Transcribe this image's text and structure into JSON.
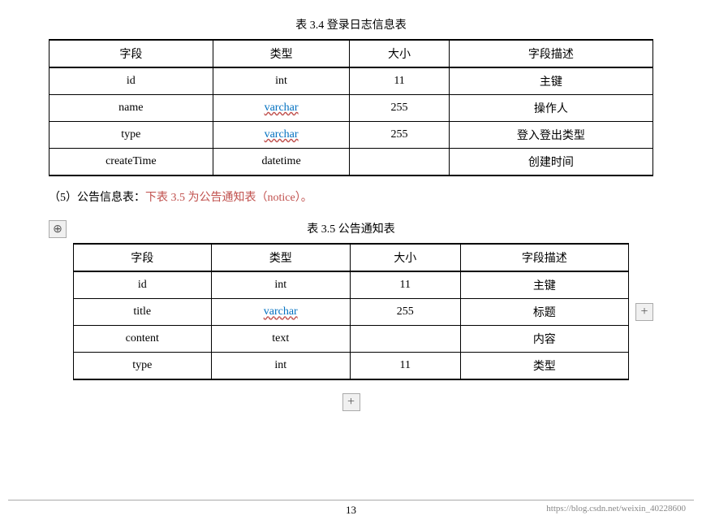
{
  "table1": {
    "title": "表 3.4  登录日志信息表",
    "headers": [
      "字段",
      "类型",
      "大小",
      "字段描述"
    ],
    "rows": [
      {
        "field": "id",
        "type": "int",
        "typeStyle": "plain",
        "size": "11",
        "desc": "主键"
      },
      {
        "field": "name",
        "type": "varchar",
        "typeStyle": "varchar",
        "size": "255",
        "desc": "操作人"
      },
      {
        "field": "type",
        "type": "varchar",
        "typeStyle": "varchar",
        "size": "255",
        "desc": "登入登出类型"
      },
      {
        "field": "createTime",
        "type": "datetime",
        "typeStyle": "plain",
        "size": "",
        "desc": "创建时间"
      }
    ]
  },
  "paragraph": {
    "prefix": "（5）公告信息表：",
    "highlight": "下表 3.5 为公告通知表（notice）。",
    "full": "（5）公告信息表：下表 3.5 为公告通知表（notice）。"
  },
  "table2": {
    "title": "表 3.5  公告通知表",
    "headers": [
      "字段",
      "类型",
      "大小",
      "字段描述"
    ],
    "rows": [
      {
        "field": "id",
        "type": "int",
        "typeStyle": "plain",
        "size": "11",
        "desc": "主键"
      },
      {
        "field": "title",
        "type": "varchar",
        "typeStyle": "varchar",
        "size": "255",
        "desc": "标题"
      },
      {
        "field": "content",
        "type": "text",
        "typeStyle": "plain",
        "size": "",
        "desc": "内容"
      },
      {
        "field": "type",
        "type": "int",
        "typeStyle": "plain",
        "size": "11",
        "desc": "类型"
      }
    ]
  },
  "footer": {
    "page_number": "13",
    "watermark": "https://blog.csdn.net/weixin_40228600"
  },
  "icons": {
    "move": "⊕",
    "add": "+"
  }
}
